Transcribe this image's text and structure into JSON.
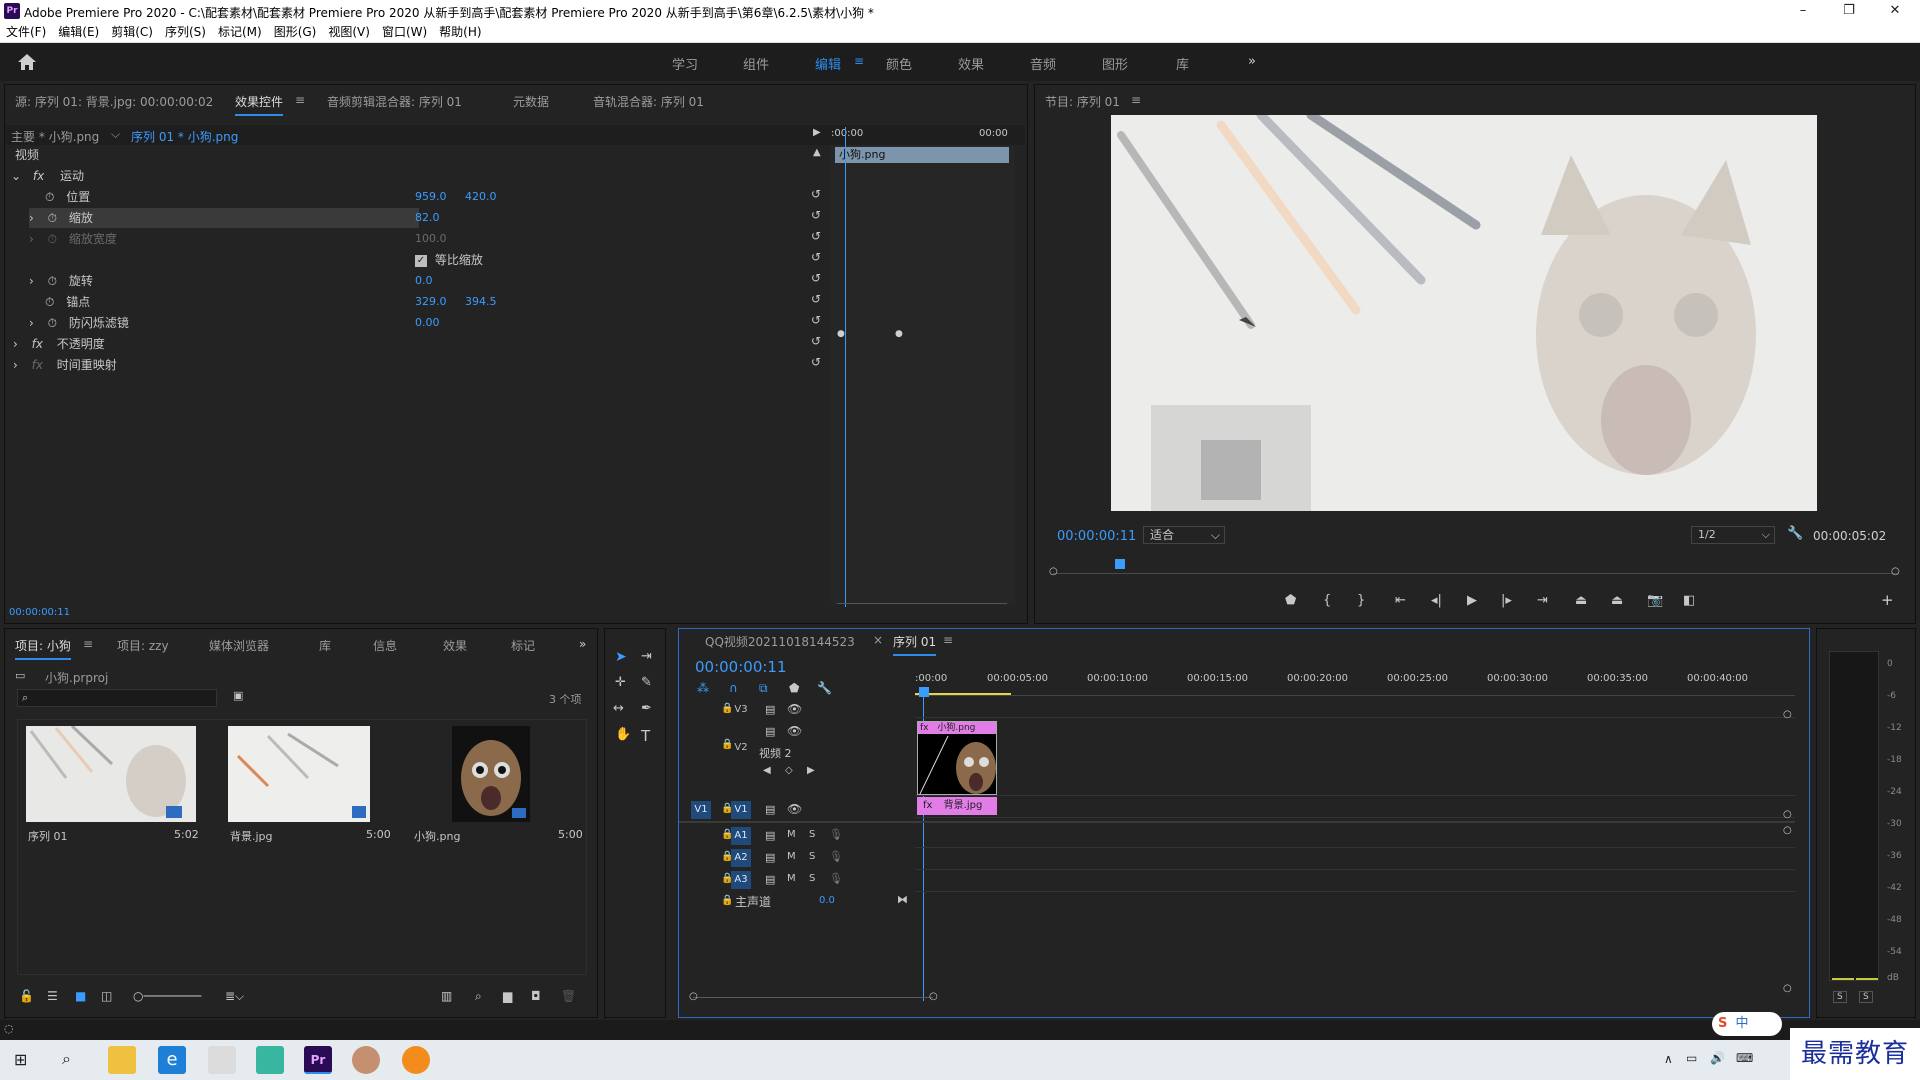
{
  "window": {
    "title": "Adobe Premiere Pro 2020 - C:\\配套素材\\配套素材 Premiere Pro 2020 从新手到高手\\配套素材 Premiere Pro 2020 从新手到高手\\第6章\\6.2.5\\素材\\小狗 *",
    "logo": "Pr",
    "controls": [
      "–",
      "❐",
      "✕"
    ]
  },
  "menu": [
    "文件(F)",
    "编辑(E)",
    "剪辑(C)",
    "序列(S)",
    "标记(M)",
    "图形(G)",
    "视图(V)",
    "窗口(W)",
    "帮助(H)"
  ],
  "workspaces": {
    "items": [
      "学习",
      "组件",
      "编辑",
      "颜色",
      "效果",
      "音频",
      "图形",
      "库"
    ],
    "active": "编辑",
    "overflow": "»"
  },
  "effect_panel": {
    "tabs": [
      "源: 序列 01: 背景.jpg: 00:00:00:02",
      "效果控件",
      "音频剪辑混合器: 序列 01",
      "元数据",
      "音轨混合器: 序列 01"
    ],
    "master_label": "主要 * 小狗.png",
    "sequence_label": "序列 01 * 小狗.png",
    "section": "视频",
    "motion": "运动",
    "properties": [
      {
        "name": "位置",
        "v1": "959.0",
        "v2": "420.0"
      },
      {
        "name": "缩放",
        "v1": "82.0",
        "v2": ""
      },
      {
        "name": "缩放宽度",
        "v1": "100.0",
        "v2": ""
      },
      {
        "name": "等比缩放",
        "v1": "",
        "v2": ""
      },
      {
        "name": "旋转",
        "v1": "0.0",
        "v2": ""
      },
      {
        "name": "锚点",
        "v1": "329.0",
        "v2": "394.5"
      },
      {
        "name": "防闪烁滤镜",
        "v1": "0.00",
        "v2": ""
      }
    ],
    "opacity": "不透明度",
    "time_remap": "时间重映射",
    "mini_ruler_start": ":00:00",
    "mini_ruler_end": "00:00",
    "clip_name": "小狗.png",
    "timecode": "00:00:00:11"
  },
  "program_monitor": {
    "title": "节目: 序列 01",
    "timecode": "00:00:00:11",
    "fit": "适合",
    "resolution": "1/2",
    "duration": "00:00:05:02"
  },
  "project_panel": {
    "tabs": [
      "项目: 小狗",
      "项目: zzy",
      "媒体浏览器",
      "库",
      "信息",
      "效果",
      "标记"
    ],
    "file": "小狗.prproj",
    "count": "3 个项",
    "items": [
      {
        "name": "序列 01",
        "duration": "5:02"
      },
      {
        "name": "背景.jpg",
        "duration": "5:00"
      },
      {
        "name": "小狗.png",
        "duration": "5:00"
      }
    ]
  },
  "timeline": {
    "tabs": [
      "QQ视频20211018144523",
      "序列 01"
    ],
    "timecode": "00:00:00:11",
    "ruler": [
      ":00:00",
      "00:00:05:00",
      "00:00:10:00",
      "00:00:15:00",
      "00:00:20:00",
      "00:00:25:00",
      "00:00:30:00",
      "00:00:35:00",
      "00:00:40:00"
    ],
    "tracks_video": [
      "V3",
      "V2",
      "V1"
    ],
    "v2_name": "视频 2",
    "tracks_audio": [
      "A1",
      "A2",
      "A3"
    ],
    "source_v1": "V1",
    "m": "M",
    "s": "S",
    "master": "主声道",
    "master_value": "0.0",
    "clip_top": "小狗.png",
    "clip_bottom": "背景.jpg",
    "fx": "fx"
  },
  "meters": {
    "labels": [
      "0",
      "-6",
      "-12",
      "-18",
      "-24",
      "-30",
      "-36",
      "-42",
      "-48",
      "-54",
      "dB"
    ],
    "solo": [
      "S",
      "S"
    ]
  },
  "overlay": {
    "ime": "中",
    "watermark": "最需教育"
  },
  "colors": {
    "accent": "#2d8ceb",
    "clip_pink": "#e27de8",
    "panel_bg": "#232323",
    "header_bg": "#1d1d1d"
  }
}
